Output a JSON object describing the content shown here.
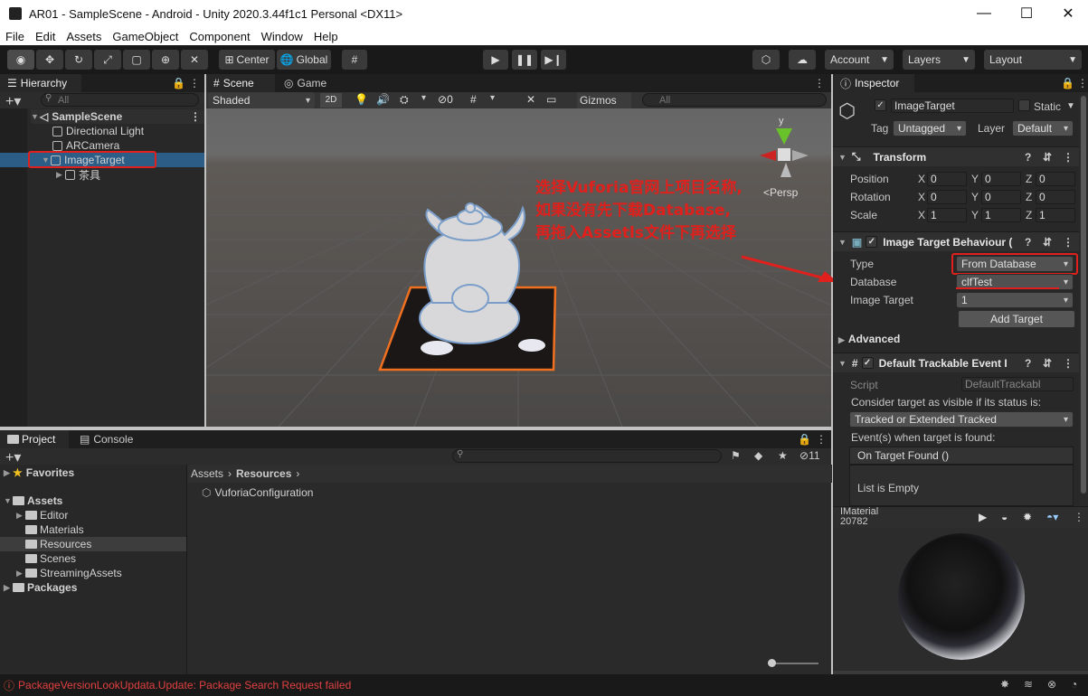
{
  "window": {
    "title": "AR01 - SampleScene - Android - Unity 2020.3.44f1c1 Personal <DX11>",
    "minimize": "—",
    "maximize": "☐",
    "close": "✕"
  },
  "menu": [
    "File",
    "Edit",
    "Assets",
    "GameObject",
    "Component",
    "Window",
    "Help"
  ],
  "toolbar": {
    "center": "Center",
    "global": "Global",
    "account": "Account",
    "layers": "Layers",
    "layout": "Layout"
  },
  "hierarchy": {
    "tab": "Hierarchy",
    "search_placeholder": "All",
    "items": [
      {
        "label": "SampleScene"
      },
      {
        "label": "Directional Light"
      },
      {
        "label": "ARCamera"
      },
      {
        "label": "ImageTarget"
      },
      {
        "label": "茶具"
      }
    ]
  },
  "scene": {
    "tabs": [
      "Scene",
      "Game"
    ],
    "shaded": "Shaded",
    "mode2d": "2D",
    "hidden_count": "0",
    "gizmos": "Gizmos",
    "search_placeholder": "All",
    "axis_y": "y",
    "persp": "<Persp",
    "annotation": [
      "选择Vuforia官网上项目名称,",
      "如果没有先下载Database,",
      "再拖入Assetls文件下再选择"
    ]
  },
  "inspector": {
    "tab": "Inspector",
    "object_name": "ImageTarget",
    "static_label": "Static",
    "tag_label": "Tag",
    "tag_value": "Untagged",
    "layer_label": "Layer",
    "layer_value": "Default",
    "transform": {
      "title": "Transform",
      "position_label": "Position",
      "rotation_label": "Rotation",
      "scale_label": "Scale",
      "x": "X",
      "y": "Y",
      "z": "Z",
      "position": [
        "0",
        "0",
        "0"
      ],
      "rotation": [
        "0",
        "0",
        "0"
      ],
      "scale": [
        "1",
        "1",
        "1"
      ]
    },
    "itb": {
      "title": "Image Target Behaviour (",
      "type_label": "Type",
      "type_value": "From Database",
      "database_label": "Database",
      "database_value": "clfTest",
      "image_target_label": "Image Target",
      "image_target_value": "1",
      "add_target": "Add Target"
    },
    "advanced": "Advanced",
    "dte": {
      "title": "Default Trackable Event I",
      "script_label": "Script",
      "script_value": "DefaultTrackabl",
      "consider_label": "Consider target as visible if its status is:",
      "status_value": "Tracked or Extended Tracked",
      "events_label": "Event(s) when target is found:",
      "on_found": "On Target Found ()",
      "list_empty": "List is Empty"
    },
    "preview": {
      "line1": "IMaterial",
      "line2": "20782"
    }
  },
  "project": {
    "tabs": [
      "Project",
      "Console"
    ],
    "hidden_count": "11",
    "favorites": "Favorites",
    "assets": "Assets",
    "folders": [
      "Editor",
      "Materials",
      "Resources",
      "Scenes",
      "StreamingAssets"
    ],
    "packages": "Packages",
    "breadcrumb": [
      "Assets",
      "Resources"
    ],
    "files": [
      "VuforiaConfiguration"
    ]
  },
  "status": {
    "message": "PackageVersionLookUpdata.Update: Package Search Request failed"
  },
  "colors": {
    "accent": "#2c5d87",
    "annotation": "#e0201c",
    "highlight_orange": "#f07020"
  }
}
